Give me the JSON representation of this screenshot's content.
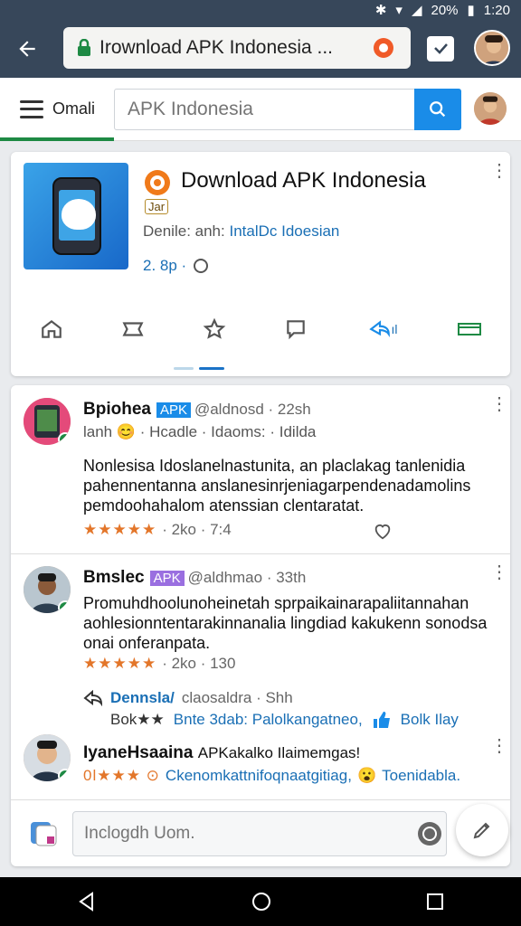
{
  "status": {
    "text": "20%",
    "time": "1:20"
  },
  "browser": {
    "url": "Irownload APK Indonesia ..."
  },
  "app_header": {
    "menu_label": "Omali",
    "search_placeholder": "APK Indonesia"
  },
  "app_card": {
    "title": "Download APK Indonesia",
    "badge": "Jar",
    "developer_prefix": "Denile: anh:",
    "developer_name": "IntalDc Idoesian",
    "rating": "2. 8p ·",
    "action_count": "ıl",
    "accent_color": "#1a8ce8"
  },
  "posts": [
    {
      "name": "Bpiohea",
      "tag": "APK",
      "handle": "@aldnosd · 22sh",
      "sub": "lanh 😊 · Hcadle · Idaoms: · Idilda",
      "body": "Nonlesisa Idoslanelnastunita, an placlakag tanlenidia pahennentanna anslanesinrjeniagarpendenadamolins pemdoohahalom atenssian clentaratat.",
      "stars": "★★★★★",
      "stats": "· 2ko · 7:4"
    },
    {
      "name": "Bmslec",
      "tag": "APK",
      "handle": "@aldhmao · 33th",
      "body": "Promuhdhoolunoheinetah sprpaikainarapaliitannahan aohlesionntentarakinnanalia lingdiad kakukenn sonodsa onai onferanpata.",
      "stars": "★★★★★",
      "stats": "· 2ko · 130",
      "reply_user": "Dennsla/",
      "reply_meta": "claosaldra · Shh",
      "reply_prefix": "Bok★★",
      "reply_text": "Bnte 3dab: Palolkangatneo,",
      "reply_tag": "Bolk Ilay"
    },
    {
      "name": "IyaneHsaaina",
      "tag_text": "APKakalko Ilaimemgas!",
      "stars_text": "0l★★★ ⊙",
      "body": "Ckenomkattnifoqnaatgitiag,",
      "tag2": "Toenidabla."
    }
  ],
  "compose": {
    "placeholder": "Inclogdh Uom."
  }
}
